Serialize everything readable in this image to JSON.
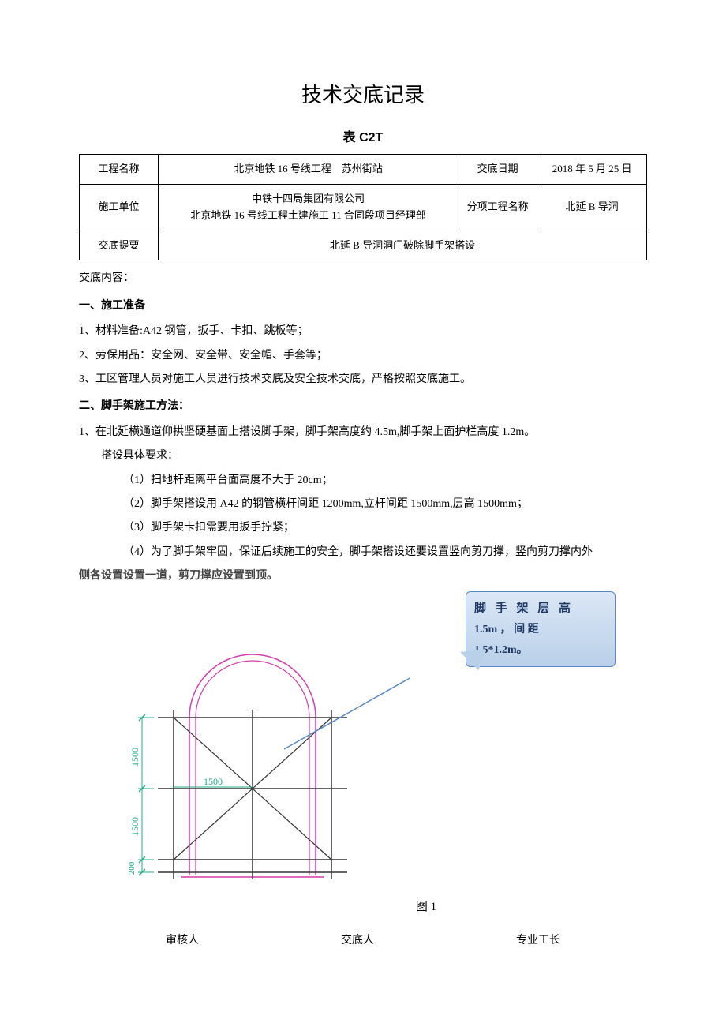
{
  "title": "技术交底记录",
  "subtitle": "表 C2T",
  "table": {
    "r1c1": "工程名称",
    "r1c2": "北京地铁 16 号线工程 苏州街站",
    "r1c3": "交底日期",
    "r1c4": "2018 年 5 月 25 日",
    "r2c1": "施工单位",
    "r2c2_l1": "中铁十四局集团有限公司",
    "r2c2_l2": "北京地铁 16 号线工程土建施工 11 合同段项目经理部",
    "r2c3": "分项工程名称",
    "r2c4": "北延 B 导洞",
    "r3c1": "交底提要",
    "r3c2": "北延 B 导洞洞门破除脚手架搭设"
  },
  "content_label": "交底内容：",
  "sec1_head": "一、施工准备",
  "sec1_items": [
    "1、材料准备:A42 钢管，扳手、卡扣、跳板等；",
    "2、劳保用品：安全网、安全带、安全帽、手套等；",
    "3、工区管理人员对施工人员进行技术交底及安全技术交底，严格按照交底施工。"
  ],
  "sec2_head": "二、脚手架施工方法：",
  "sec2_p1": "1、在北延横通道仰拱坚硬基面上搭设脚手架，脚手架高度约 4.5m,脚手架上面护栏高度 1.2m。",
  "sec2_p2": "搭设具体要求：",
  "sec2_list": [
    "（1）扫地杆距离平台面高度不大于 20cm；",
    "（2）脚手架搭设用 A42 的钢管横杆间距 1200mm,立杆间距 1500mm,层高 1500mm；",
    "（3）脚手架卡扣需要用扳手拧紧；"
  ],
  "sec2_p4a": "（4）为了脚手架牢固，保证后续施工的安全，脚手架搭设还要设置竖向剪刀撑，竖向剪刀撑内外",
  "sec2_p4b": "侧各设置设置一道，剪刀撑应设置到顶。",
  "callout_l1": "脚 手 架 层 高",
  "callout_l2": "1.5m   ，   间   距",
  "callout_l3": "1.5*1.2m。",
  "dim_1500a": "1500",
  "dim_1500b": "1500",
  "dim_200": "200",
  "fig_label": "图 1",
  "footer": {
    "a": "审核人",
    "b": "交底人",
    "c": "专业工长"
  }
}
